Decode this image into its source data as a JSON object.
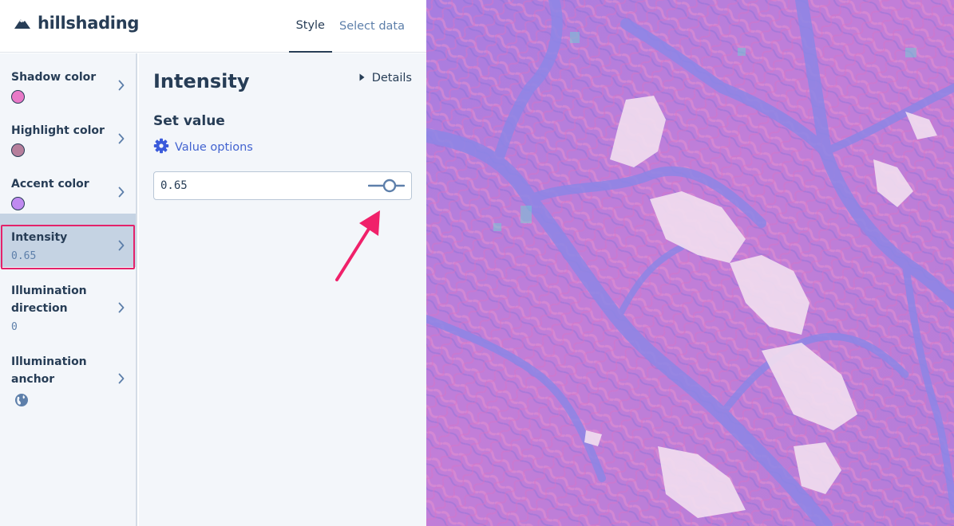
{
  "app": {
    "title": "hillshading",
    "logo_icon": "mountain-icon"
  },
  "tabs": [
    {
      "label": "Style",
      "active": true
    },
    {
      "label": "Select data",
      "active": false
    }
  ],
  "sidebar": {
    "items": [
      {
        "label": "Shadow color",
        "swatch": "#e879c7",
        "icon": "chevron-right-icon"
      },
      {
        "label": "Highlight color",
        "swatch": "#b67f9c",
        "icon": "chevron-right-icon"
      },
      {
        "label": "Accent color",
        "swatch": "#c08af0",
        "icon": "chevron-right-icon"
      },
      {
        "label": "Intensity",
        "value": "0.65",
        "selected": true,
        "icon": "chevron-right-icon"
      },
      {
        "label_line1": "Illumination",
        "label_line2": "direction",
        "value": "0",
        "icon": "chevron-right-icon"
      },
      {
        "label_line1": "Illumination",
        "label_line2": "anchor",
        "value_icon": "globe-icon",
        "icon": "chevron-right-icon"
      }
    ]
  },
  "panel": {
    "title": "Intensity",
    "details_label": "Details",
    "set_value_label": "Set value",
    "value_options_label": "Value options",
    "input_value": "0.65"
  },
  "colors": {
    "accent": "#3b5bdb",
    "highlight_border": "#e4226a",
    "selected_bg": "#c5d3e3",
    "map_base": "#b77fd6"
  }
}
